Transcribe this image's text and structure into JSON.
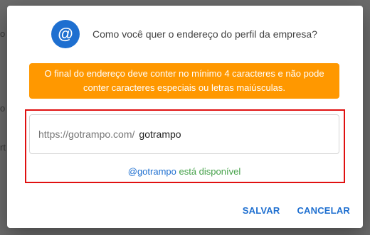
{
  "dialog": {
    "title": "Como você quer o endereço do perfil da empresa?",
    "icon": "at-sign-icon",
    "accent_color": "#1e6fd0",
    "warning": {
      "text": "O final do endereço deve conter no mínimo 4 caracteres e não pode conter caracteres especiais ou letras maiúsculas.",
      "color": "#ff9800"
    },
    "url_field": {
      "prefix": "https://gotrampo.com/",
      "value": "gotrampo"
    },
    "availability": {
      "handle": "@gotrampo",
      "status": "está disponível",
      "status_color": "#43a047"
    },
    "buttons": {
      "save": "SALVAR",
      "cancel": "CANCELAR"
    }
  }
}
